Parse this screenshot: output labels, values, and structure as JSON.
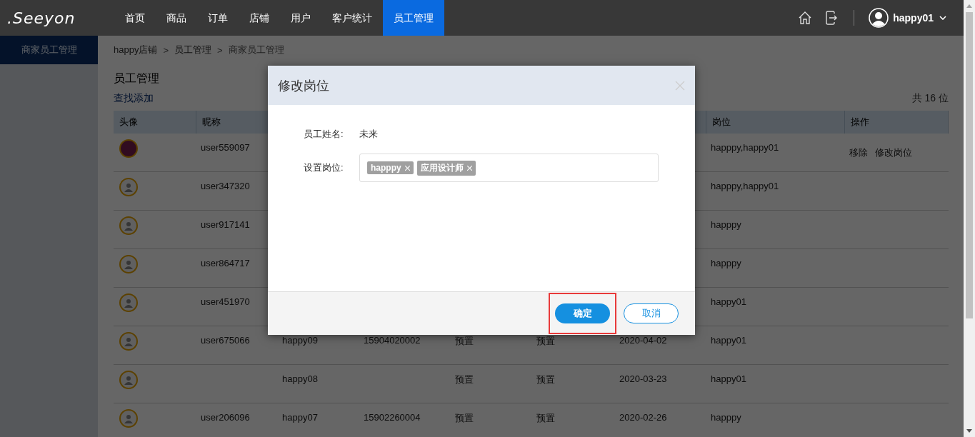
{
  "header": {
    "logo": ".Seeyon",
    "nav": [
      {
        "label": "首页",
        "selected": false
      },
      {
        "label": "商品",
        "selected": false
      },
      {
        "label": "订单",
        "selected": false
      },
      {
        "label": "店铺",
        "selected": false
      },
      {
        "label": "用户",
        "selected": false
      },
      {
        "label": "客户统计",
        "selected": false
      },
      {
        "label": "员工管理",
        "selected": true
      }
    ],
    "user": "happy01"
  },
  "sidebar": {
    "items": [
      {
        "label": "商家员工管理",
        "selected": true
      }
    ]
  },
  "breadcrumb": [
    {
      "label": "happy店铺",
      "current": false
    },
    {
      "label": ">",
      "kind": "sep"
    },
    {
      "label": "员工管理",
      "current": false
    },
    {
      "label": ">",
      "kind": "sep"
    },
    {
      "label": "商家员工管理",
      "current": true
    }
  ],
  "page_title": "员工管理",
  "find_add_link": "查找添加",
  "total": "共 16 位",
  "table": {
    "header": {
      "avatar": "头像",
      "nickname": "昵称",
      "post": "岗位",
      "actions": "操作"
    },
    "rows": [
      {
        "kind": "photo",
        "nickname": "user559097",
        "post": "happpy,happy01",
        "actions": [
          "移除",
          "修改岗位"
        ]
      },
      {
        "kind": "default",
        "nickname": "user347320",
        "post": "happpy,happy01"
      },
      {
        "kind": "default",
        "nickname": "user917141",
        "post": "happpy"
      },
      {
        "kind": "default",
        "nickname": "user864717",
        "post": "happpy"
      },
      {
        "kind": "default",
        "nickname": "user451970",
        "post": "happy01"
      },
      {
        "kind": "default",
        "nickname": "user675066",
        "column_3": "happy09",
        "column_4": "15904020002",
        "column_5": "预置",
        "column_6": "预置",
        "column_7": "2020-04-02",
        "post": "happy01"
      },
      {
        "kind": "default",
        "column_3": "happy08",
        "column_5": "预置",
        "column_6": "预置",
        "column_7": "2020-03-23",
        "post": "happy01"
      },
      {
        "kind": "default",
        "nickname": "user206096",
        "column_3": "happy07",
        "column_4": "15902260004",
        "column_5": "预置",
        "column_6": "预置",
        "column_7": "2020-02-26",
        "post": "happpy"
      }
    ]
  },
  "dialog": {
    "title": "修改岗位",
    "name_label": "员工姓名:",
    "name_value": "未来",
    "post_label": "设置岗位:",
    "tags": [
      "happpy",
      "应用设计师"
    ],
    "buttons": [
      {
        "label": "确定",
        "kind": "primary",
        "highlighted": true
      },
      {
        "label": "取消",
        "kind": "secondary",
        "highlighted": false
      }
    ]
  }
}
